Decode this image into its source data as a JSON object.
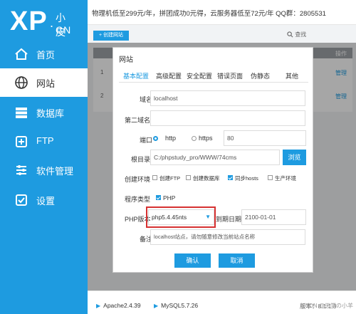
{
  "sidebar": {
    "logo_xp": "XP",
    "logo_dot": ".",
    "logo_cn_top": "小皮",
    "logo_cn_bottom": "CN",
    "items": [
      {
        "label": "首页",
        "icon": "home-icon"
      },
      {
        "label": "网站",
        "icon": "globe-icon"
      },
      {
        "label": "数据库",
        "icon": "database-icon"
      },
      {
        "label": "FTP",
        "icon": "ftp-icon"
      },
      {
        "label": "软件管理",
        "icon": "sliders-icon"
      },
      {
        "label": "设置",
        "icon": "gear-icon"
      }
    ],
    "active_index": 1,
    "color": "#1e9be0"
  },
  "topbar": {
    "notice": "物理机低至299元/年，拼团成功0元得，云服务器低至72元/年 QQ群：2805531"
  },
  "toolbar": {
    "create_label": "+ 创建网站",
    "search_label": "查找"
  },
  "bgtable": {
    "op_header": "操作",
    "rows": [
      {
        "no": "1",
        "action": "管理"
      },
      {
        "no": "2",
        "action": "管理"
      }
    ]
  },
  "dialog": {
    "title": "网站",
    "tabs": [
      "基本配置",
      "高级配置",
      "安全配置",
      "错误页面",
      "伪静态",
      "其他"
    ],
    "active_tab": 0,
    "domain_label": "域名",
    "domain_value": "localhost",
    "second_domain_label": "第二域名",
    "second_domain_value": "",
    "port_label": "端口",
    "protocol_http": "http",
    "protocol_https": "https",
    "protocol_selected": "http",
    "port_value": "80",
    "root_label": "根目录",
    "root_value": "C:/phpstudy_pro/WWW/74cms",
    "browse_label": "浏览",
    "env_label": "创建环境",
    "env_options": [
      {
        "label": "创建FTP",
        "checked": false
      },
      {
        "label": "创建数据库",
        "checked": false
      },
      {
        "label": "同步hosts",
        "checked": true
      },
      {
        "label": "生产环境",
        "checked": false
      }
    ],
    "program_type_label": "程序类型",
    "program_php_label": "PHP",
    "program_php_checked": true,
    "php_version_label": "PHP版本",
    "php_version_value": "php5.4.45nts",
    "expire_label": "到期日期",
    "expire_value": "2100-01-01",
    "remark_label": "备注",
    "remark_value": "localhost站点，请勿随意修改当前站点名称",
    "ok_label": "确认",
    "cancel_label": "取消"
  },
  "footer": {
    "services": [
      {
        "name": "Apache2.4.39"
      },
      {
        "name": "MySQL5.7.26"
      }
    ],
    "version": "版本：8.1.1.3"
  },
  "watermark": "CSDN @天堂の小羊"
}
